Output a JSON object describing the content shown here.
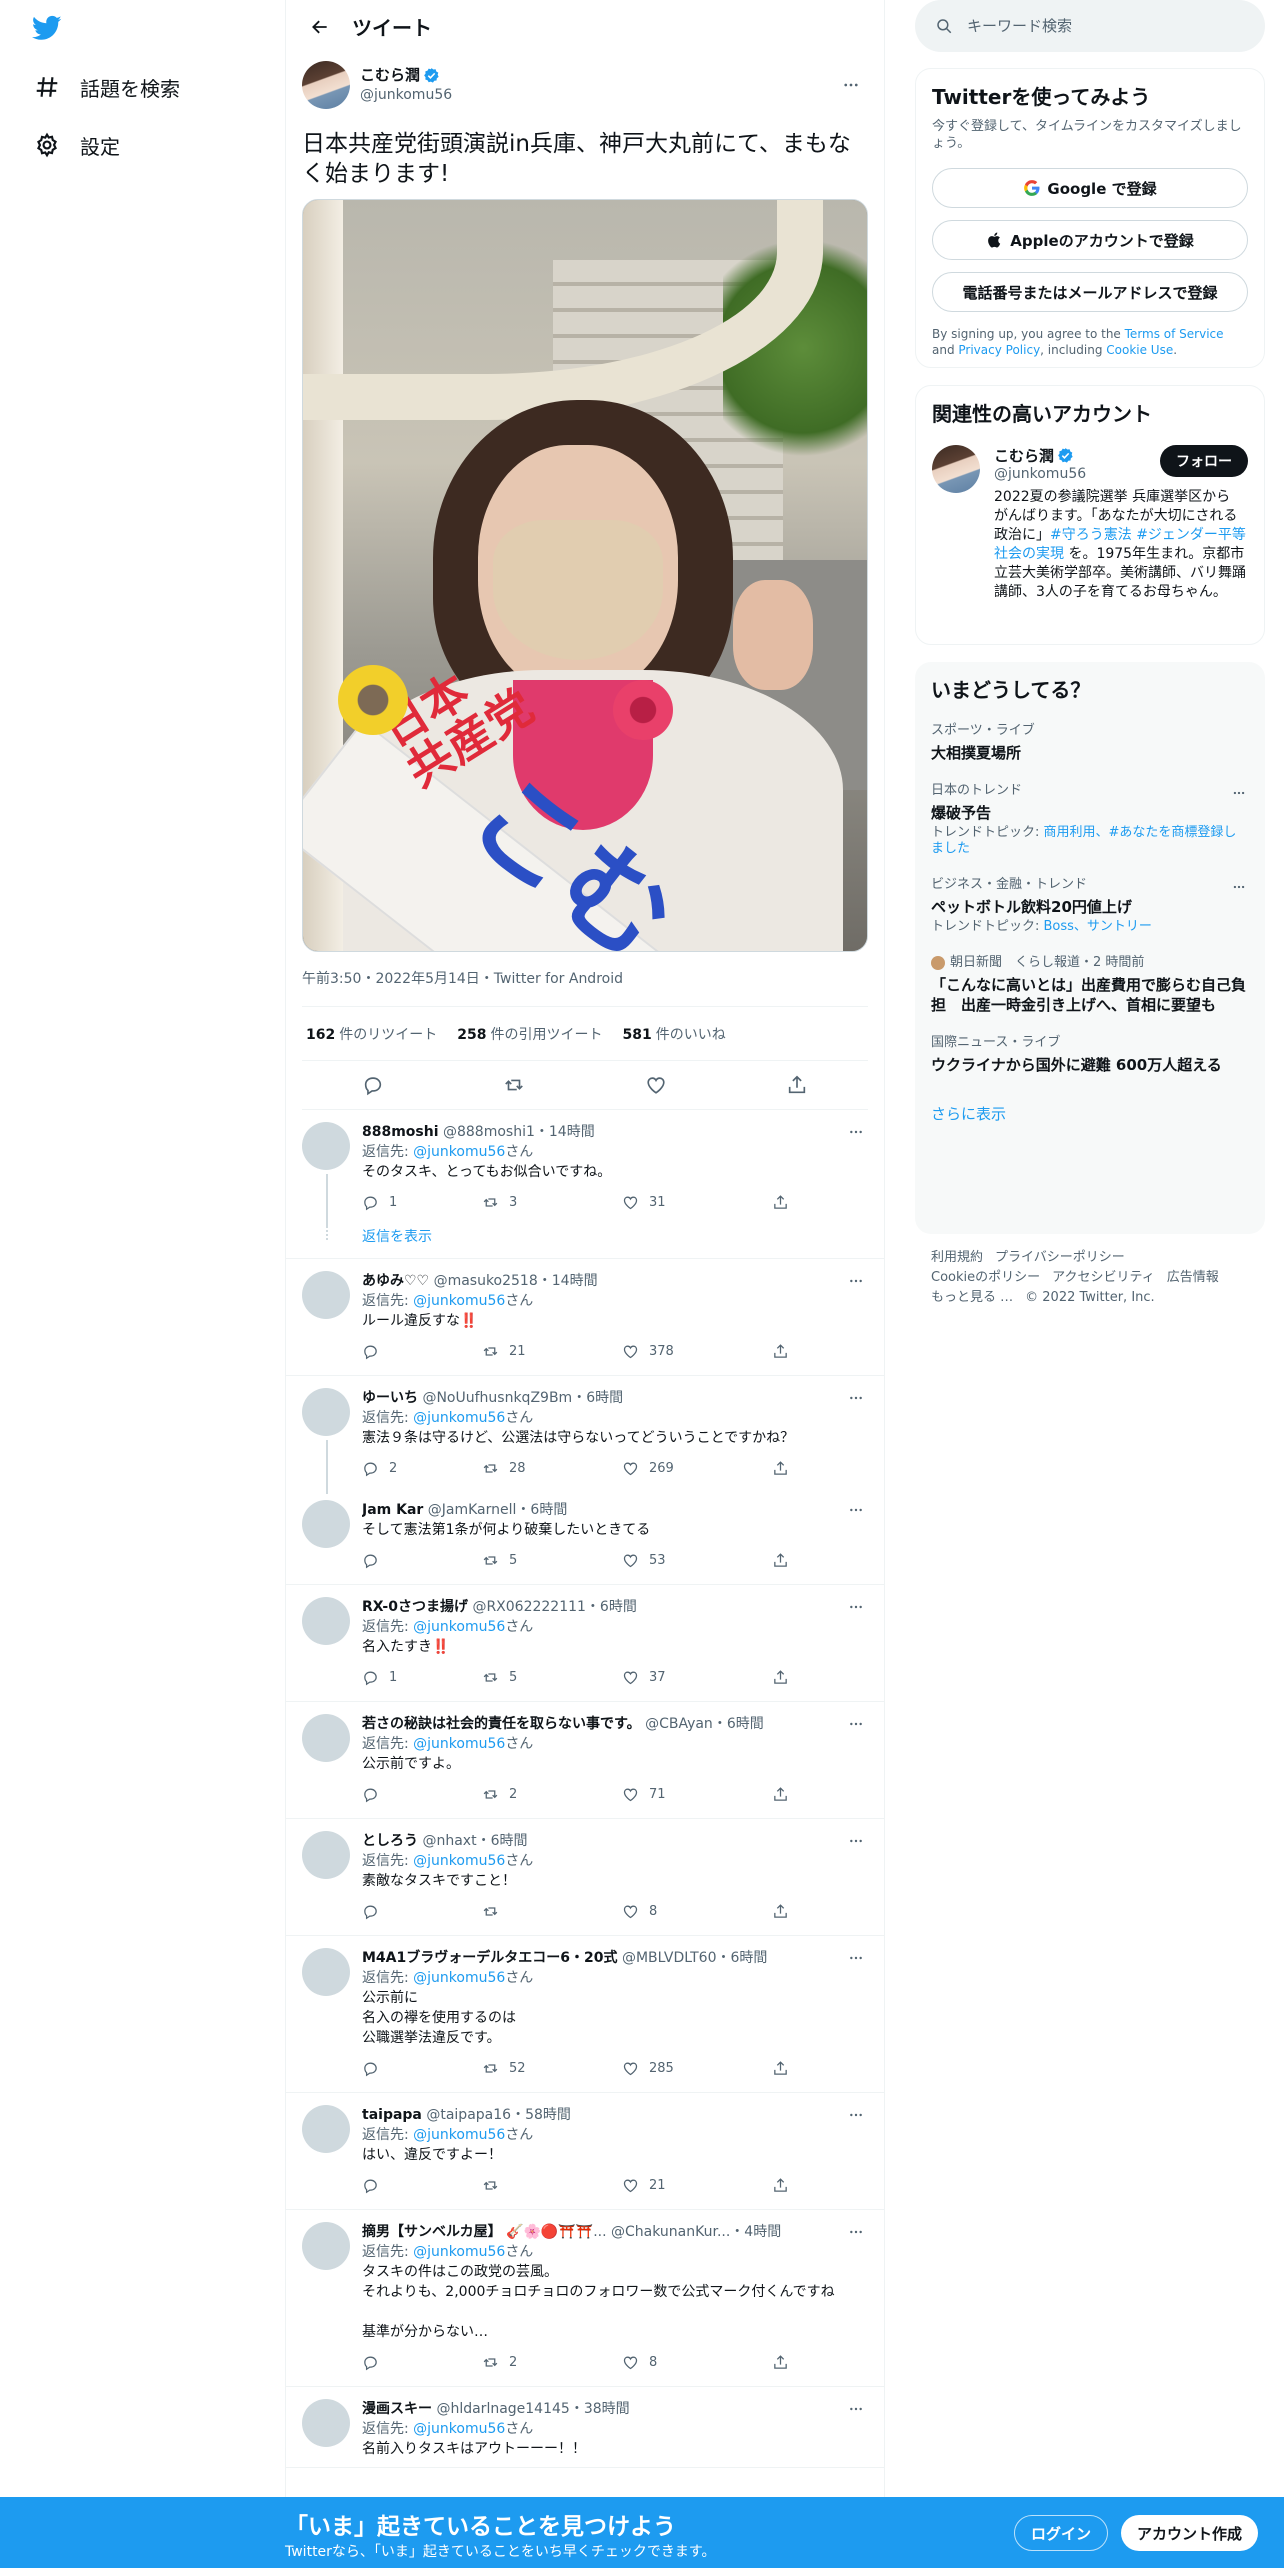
{
  "nav": {
    "items": [
      {
        "label": "話題を検索",
        "icon": "hashtag-icon"
      },
      {
        "label": "設定",
        "icon": "gear-icon"
      }
    ]
  },
  "header": {
    "title": "ツイート"
  },
  "tweet": {
    "author_name": "こむら潤",
    "author_handle": "@junkomu56",
    "text": "日本共産党街頭演説in兵庫、神戸大丸前にて、まもなく始まります!",
    "meta": "午前3:50・2022年5月14日・Twitter for Android",
    "photo_text_1": "日本\n共産党",
    "photo_text_2": "こむ",
    "stats": {
      "retweets_count": "162",
      "retweets_label": "件のリツイート",
      "quotes_count": "258",
      "quotes_label": "件の引用ツイート",
      "likes_count": "581",
      "likes_label": "件のいいね"
    }
  },
  "replies": [
    {
      "name": "888moshi",
      "handle": "@888moshi1",
      "time": "14時間",
      "replying": "返信先: ",
      "mention": "@junkomu56",
      "suffix": "さん",
      "text": "そのタスキ、とってもお似合いですね。",
      "replies": "1",
      "retweets": "3",
      "likes": "31"
    },
    {
      "name": "あゆみ♡♡",
      "handle": "@masuko2518",
      "time": "14時間",
      "replying": "返信先: ",
      "mention": "@junkomu56",
      "suffix": "さん",
      "text": "ルール違反すな",
      "text_emoji": "‼️",
      "replies": "",
      "retweets": "21",
      "likes": "378"
    },
    {
      "name": "ゆーいち",
      "handle": "@NoUufhusnkqZ9Bm",
      "time": "6時間",
      "replying": "返信先: ",
      "mention": "@junkomu56",
      "suffix": "さん",
      "text": "憲法９条は守るけど、公選法は守らないってどういうことですかね？",
      "replies": "2",
      "retweets": "28",
      "likes": "269"
    },
    {
      "name": "Jam Kar",
      "handle": "@JamKarnell",
      "time": "6時間",
      "text": "そして憲法第1条が何より破棄したいときてる",
      "replies": "",
      "retweets": "5",
      "likes": "53"
    },
    {
      "name": "RX-0さつま揚げ",
      "handle": "@RX062222111",
      "time": "6時間",
      "replying": "返信先: ",
      "mention": "@junkomu56",
      "suffix": "さん",
      "text": "名入たすき",
      "text_emoji": "‼️",
      "replies": "1",
      "retweets": "5",
      "likes": "37"
    },
    {
      "name": "若さの秘訣は社会的責任を取らない事です。",
      "handle": "@CBAyan",
      "time": "6時間",
      "replying": "返信先: ",
      "mention": "@junkomu56",
      "suffix": "さん",
      "text": "公示前ですよ。",
      "replies": "",
      "retweets": "2",
      "likes": "71"
    },
    {
      "name": "としろう",
      "handle": "@nhaxt",
      "time": "6時間",
      "replying": "返信先: ",
      "mention": "@junkomu56",
      "suffix": "さん",
      "text": "素敵なタスキですこと！",
      "replies": "",
      "retweets": "",
      "likes": "8"
    },
    {
      "name": "M4A1ブラヴォーデルタエコー6・20式",
      "handle": "@MBLVDLT60",
      "time": "6時間",
      "replying": "返信先: ",
      "mention": "@junkomu56",
      "suffix": "さん",
      "text": "公示前に\n名入の襷を使用するのは\n公職選挙法違反です。",
      "replies": "",
      "retweets": "52",
      "likes": "285"
    },
    {
      "name": "taipapa",
      "handle": "@taipapa16",
      "time": "58時間",
      "replying": "返信先: ",
      "mention": "@junkomu56",
      "suffix": "さん",
      "text": "はい、違反ですよー！",
      "replies": "",
      "retweets": "",
      "likes": "21"
    },
    {
      "name": "摘男【サンベルカ屋】",
      "name_emoji": "🎸🌸🔴⛩️⛩️...",
      "handle": "@ChakunanKur...",
      "time": "4時間",
      "replying": "返信先: ",
      "mention": "@junkomu56",
      "suffix": "さん",
      "text": "タスキの件はこの政党の芸風。\nそれよりも、2,000チョロチョロのフォロワー数で公式マーク付くんですね\n\n基準が分からない…",
      "replies": "",
      "retweets": "2",
      "likes": "8"
    },
    {
      "name": "漫画スキー",
      "handle": "@hldarlnage14145",
      "time": "38時間",
      "replying": "返信先: ",
      "mention": "@junkomu56",
      "suffix": "さん",
      "text": "名前入りタスキはアウトーーー！！"
    }
  ],
  "thread": {
    "show_replies": "返信を表示"
  },
  "search": {
    "placeholder": "キーワード検索"
  },
  "signup": {
    "title": "Twitterを使ってみよう",
    "subtitle": "今すぐ登録して、タイムラインをカスタマイズしましょう。",
    "google": "Google で登録",
    "apple": "Appleのアカウントで登録",
    "phone": "電話番号またはメールアドレスで登録",
    "legal_1": "By signing up, you agree to the ",
    "legal_tos": "Terms of Service",
    "legal_2": " and ",
    "legal_privacy": "Privacy Policy",
    "legal_3": ", including ",
    "legal_cookie": "Cookie Use",
    "legal_4": "."
  },
  "relevant": {
    "title": "関連性の高いアカウント",
    "name": "こむら潤",
    "handle": "@junkomu56",
    "follow": "フォロー",
    "bio_1": "2022夏の参議院選挙 兵庫選挙区から がんばります。「あなたが大切にされる政治に」",
    "bio_ht1": "#守ろう憲法",
    "bio_sp": " ",
    "bio_ht2": "#ジェンダー平等社会の実現",
    "bio_2": " を。1975年生まれ。京都市立芸大美術学部卒。美術講師、バリ舞踊講師、3人の子を育てるお母ちゃん。"
  },
  "trends": {
    "title": "いまどうしてる？",
    "items": [
      {
        "category": "スポーツ・ライブ",
        "title": "大相撲夏場所"
      },
      {
        "category": "日本のトレンド",
        "title": "爆破予告",
        "sub": "トレンドトピック: ",
        "sub_links": "商用利用、#あなたを商標登録しました"
      },
      {
        "category": "ビジネス・金融・トレンド",
        "title": "ペットボトル飲料20円値上げ",
        "sub": "トレンドトピック: ",
        "sub_links": "Boss、サントリー"
      },
      {
        "category": "朝日新聞　くらし報道・2 時間前",
        "title": "「こんなに高いとは」出産費用で膨らむ自己負担　出産一時金引き上げへ、首相に要望も"
      },
      {
        "category": "国際ニュース・ライブ",
        "title": "ウクライナから国外に避難 600万人超える"
      }
    ],
    "show_more": "さらに表示"
  },
  "footer": {
    "links": [
      "利用規約",
      "プライバシーポリシー",
      "Cookieのポリシー",
      "アクセシビリティ",
      "広告情報",
      "もっと見る …"
    ],
    "copyright": "© 2022 Twitter, Inc."
  },
  "bottombar": {
    "title": "「いま」起きていることを見つけよう",
    "subtitle": "Twitterなら、「いま」起きていることをいち早くチェックできます。",
    "login": "ログイン",
    "signup": "アカウント作成"
  },
  "colors": {
    "accent": "#1d9bf0",
    "text": "#0f1419",
    "muted": "#536471",
    "follow_bg": "#0f1419"
  }
}
